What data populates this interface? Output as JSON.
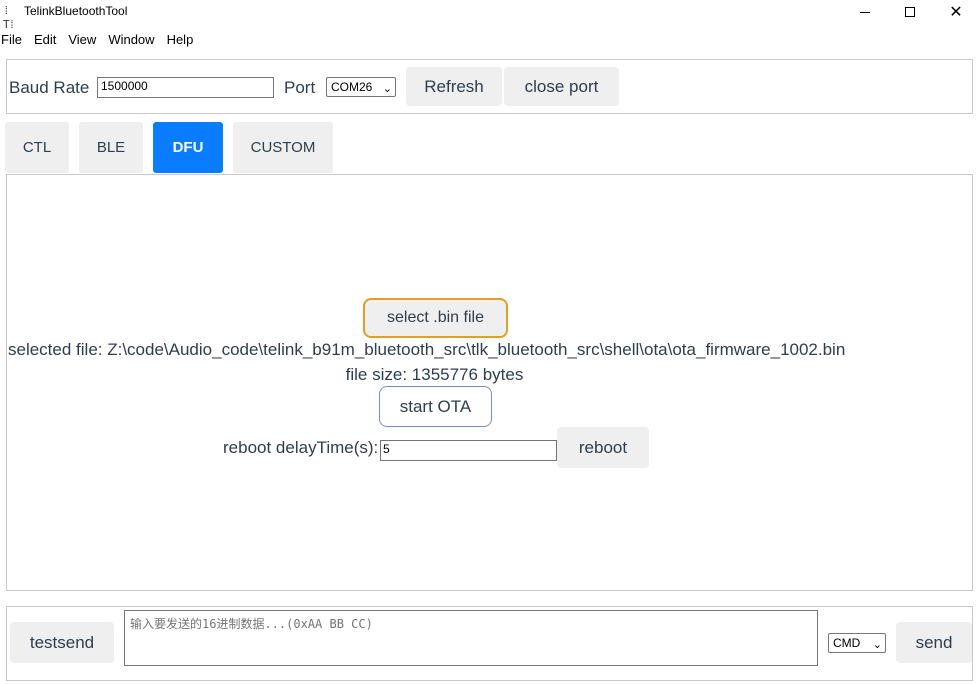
{
  "window": {
    "title": "TelinkBluetoothTool",
    "icon_glyph": "⁞T⁞",
    "minimize_icon": "minimize-icon",
    "maximize_icon": "maximize-icon",
    "close_icon": "close-icon",
    "close_glyph": "✕"
  },
  "menu": [
    "File",
    "Edit",
    "View",
    "Window",
    "Help"
  ],
  "port_panel": {
    "baud_label": "Baud Rate",
    "baud_value": "1500000",
    "port_label": "Port",
    "port_selected": "COM26",
    "refresh_label": "Refresh",
    "close_port_label": "close port"
  },
  "tabs": [
    {
      "label": "CTL",
      "active": false
    },
    {
      "label": "BLE",
      "active": false
    },
    {
      "label": "DFU",
      "active": true
    },
    {
      "label": "CUSTOM",
      "active": false
    }
  ],
  "dfu": {
    "select_file_label": "select .bin file",
    "selected_file_text": "selected file: Z:\\code\\Audio_code\\telink_b91m_bluetooth_src\\tlk_bluetooth_src\\shell\\ota\\ota_firmware_1002.bin",
    "file_size_text": "file size: 1355776 bytes",
    "start_ota_label": "start OTA",
    "reboot_delay_label": "reboot delayTime(s):",
    "reboot_delay_value": "5",
    "reboot_label": "reboot"
  },
  "bottom": {
    "testsend_label": "testsend",
    "input_placeholder": "输入要发送的16进制数据...(0xAA BB CC)",
    "cmd_selected": "CMD",
    "send_label": "send"
  },
  "colors": {
    "active_tab": "#0a7cff",
    "select_file_border": "#e0a020",
    "start_ota_border": "#7b86e0",
    "text": "#2c3e50"
  }
}
